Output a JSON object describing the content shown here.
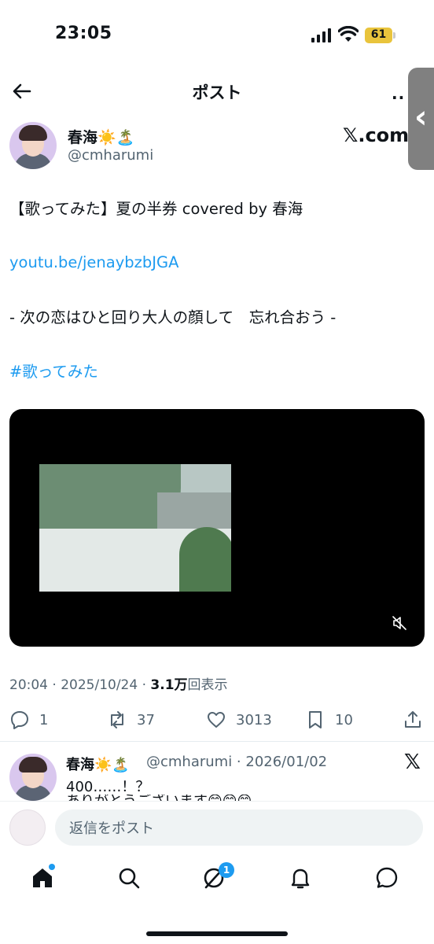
{
  "status_bar": {
    "time": "23:05",
    "battery": "61",
    "colors": {
      "battery": "#e9c43c"
    }
  },
  "header": {
    "title": "ポスト",
    "back_icon": "arrow-left-icon",
    "more_icon": "more-dots-icon",
    "more_label": "··"
  },
  "post": {
    "author": {
      "name": "春海☀️🏝️",
      "handle": "@cmharumi"
    },
    "watermark": "𝕏.com",
    "lines": [
      "【歌ってみた】夏の半券 covered by 春海",
      "youtu.be/jenaybzbJGA",
      "- 次の恋はひと回り大人の顔して　忘れ合おう -",
      "#歌ってみた"
    ],
    "timestamp_prefix": "20:04 · 2025/10/24 · ",
    "views_count": "3.1万",
    "views_label": "回表示",
    "stats": {
      "replies": "1",
      "reposts": "37",
      "likes": "3013",
      "bookmarks": "10"
    },
    "colors": {
      "link": "#1d9bf0",
      "muted": "#536471"
    }
  },
  "reply": {
    "name": "春海☀️🏝️",
    "meta": "@cmharumi · 2026/01/02",
    "x_icon": "𝕏",
    "text": "400……！？",
    "text_cut": "ありがとうございます😊😊😊"
  },
  "composer": {
    "placeholder": "返信をポスト"
  },
  "bottom_nav": {
    "items": [
      "home-icon",
      "search-icon",
      "grok-icon",
      "bell-icon",
      "messages-icon"
    ],
    "grok_badge": "1"
  }
}
